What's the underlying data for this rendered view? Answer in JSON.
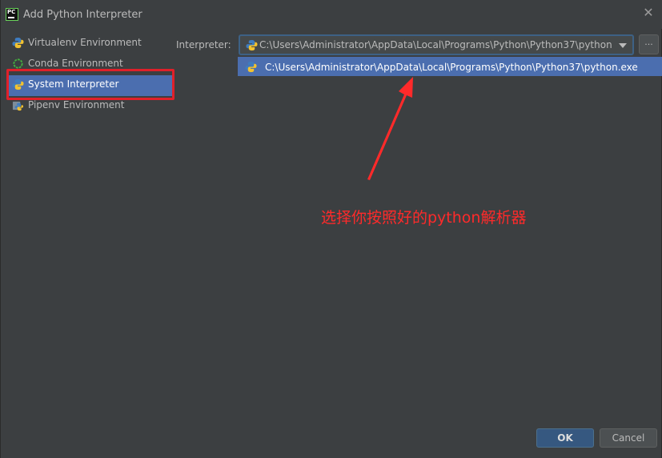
{
  "window": {
    "title": "Add Python Interpreter",
    "app_icon_text": "PC"
  },
  "sidebar": {
    "items": [
      {
        "label": "Virtualenv Environment",
        "icon": "python-icon"
      },
      {
        "label": "Conda Environment",
        "icon": "conda-icon"
      },
      {
        "label": "System Interpreter",
        "icon": "python-icon",
        "selected": true
      },
      {
        "label": "Pipenv Environment",
        "icon": "pipenv-icon"
      }
    ]
  },
  "interpreter": {
    "label": "Interpreter:",
    "value": "C:\\Users\\Administrator\\AppData\\Local\\Programs\\Python\\Python37\\python.exe",
    "browse_label": "...",
    "options": [
      "C:\\Users\\Administrator\\AppData\\Local\\Programs\\Python\\Python37\\python.exe"
    ]
  },
  "annotation": {
    "text": "选择你按照好的python解析器",
    "color": "#ff2a2a"
  },
  "buttons": {
    "ok": "OK",
    "cancel": "Cancel"
  },
  "colors": {
    "background": "#3c3f41",
    "selection": "#4b6eaf",
    "highlight_outline": "#e0202a"
  }
}
